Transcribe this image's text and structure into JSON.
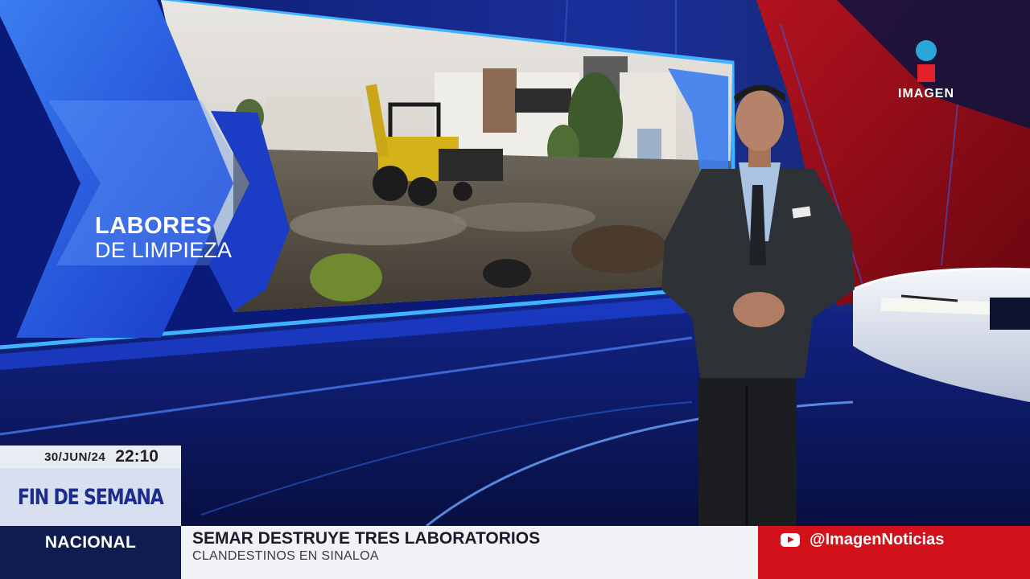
{
  "graphic": {
    "title_line1": "LABORES",
    "title_line2": "DE LIMPIEZA"
  },
  "logo": {
    "name": "IMAGEN",
    "dot_color": "#2aa7d8",
    "square_color": "#e1222b"
  },
  "lower_third": {
    "date": "30/JUN/24",
    "time": "22:10",
    "show": "FIN DE SEMANA"
  },
  "ticker": {
    "section": "NACIONAL",
    "headline": "SEMAR DESTRUYE TRES LABORATORIOS",
    "subheadline": "CLANDESTINOS EN SINALOA",
    "social_icon": "youtube-icon",
    "social_handle": "@ImagenNoticias"
  },
  "colors": {
    "brand_red": "#d3111b",
    "brand_navy": "#0f1c4f",
    "studio_blue": "#1f4fd6"
  }
}
